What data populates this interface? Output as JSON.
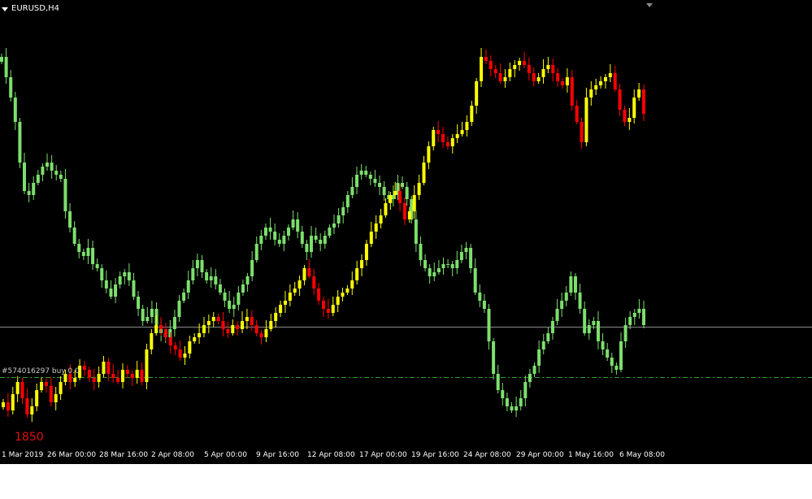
{
  "window": {
    "title": "EURUSD,H4"
  },
  "labels": {
    "order": "#574016297 buy 0.0",
    "counter": "1850"
  },
  "colors": {
    "background": "#000000",
    "foreground": "#ffffff",
    "series1_bull": "#ffff00",
    "series1_bear": "#ff0000",
    "series2": "#7ddf6d",
    "horizontal_line": "#8a8a8a",
    "order_line": "#2fa12f"
  },
  "chart_data": {
    "type": "candlestick",
    "symbol": "EURUSD",
    "timeframe": "H4",
    "x_tick_labels": [
      "1 Mar 2019",
      "26 Mar 00:00",
      "28 Mar 16:00",
      "2 Apr 08:00",
      "5 Apr 00:00",
      "9 Apr 16:00",
      "12 Apr 08:00",
      "17 Apr 00:00",
      "19 Apr 16:00",
      "24 Apr 08:00",
      "29 Apr 00:00",
      "1 May 16:00",
      "6 May 08:00"
    ],
    "y_scale": "unlabeled (price axis not shown)",
    "series": [
      {
        "style": "candles",
        "bull_color": "#ffff00",
        "bear_color": "#ff0000",
        "closes": [
          495,
          505,
          485,
          470,
          490,
          510,
          500,
          480,
          470,
          475,
          495,
          485,
          470,
          460,
          470,
          465,
          450,
          455,
          465,
          470,
          460,
          445,
          460,
          465,
          470,
          455,
          460,
          465,
          455,
          470,
          430,
          410,
          400,
          405,
          415,
          425,
          430,
          440,
          435,
          420,
          415,
          410,
          400,
          395,
          390,
          395,
          405,
          410,
          400,
          405,
          395,
          390,
          400,
          410,
          415,
          405,
          395,
          385,
          375,
          370,
          360,
          355,
          345,
          330,
          340,
          355,
          370,
          380,
          385,
          375,
          365,
          360,
          355,
          345,
          330,
          320,
          300,
          285,
          275,
          265,
          250,
          240,
          235,
          250,
          270,
          260,
          240,
          225,
          200,
          180,
          160,
          165,
          175,
          180,
          170,
          165,
          160,
          150,
          130,
          100,
          70,
          75,
          85,
          90,
          100,
          95,
          85,
          80,
          75,
          80,
          90,
          100,
          95,
          85,
          80,
          90,
          100,
          105,
          95,
          130,
          150,
          175,
          120,
          110,
          105,
          100,
          95,
          90,
          110,
          135,
          150,
          145,
          120,
          110,
          140
        ]
      },
      {
        "style": "candles",
        "color": "#7ddf6d",
        "closes": [
          70,
          95,
          120,
          150,
          200,
          235,
          240,
          225,
          215,
          205,
          200,
          210,
          215,
          220,
          260,
          280,
          300,
          310,
          315,
          305,
          325,
          330,
          345,
          355,
          365,
          350,
          340,
          335,
          345,
          365,
          380,
          395,
          390,
          380,
          400,
          410,
          415,
          405,
          390,
          370,
          360,
          345,
          330,
          320,
          335,
          345,
          340,
          350,
          360,
          370,
          380,
          375,
          360,
          350,
          340,
          320,
          300,
          290,
          280,
          285,
          295,
          300,
          290,
          280,
          270,
          285,
          300,
          310,
          290,
          295,
          300,
          290,
          280,
          275,
          265,
          255,
          240,
          230,
          215,
          210,
          215,
          220,
          225,
          230,
          240,
          245,
          240,
          225,
          230,
          245,
          270,
          300,
          320,
          330,
          340,
          335,
          330,
          325,
          325,
          330,
          320,
          310,
          305,
          330,
          360,
          370,
          380,
          420,
          460,
          480,
          490,
          500,
          505,
          500,
          490,
          470,
          460,
          450,
          430,
          420,
          410,
          395,
          380,
          370,
          360,
          340,
          360,
          380,
          410,
          400,
          395,
          420,
          430,
          440,
          450,
          455,
          420,
          400,
          390,
          385,
          380,
          400
        ]
      }
    ],
    "horizontal_lines": [
      {
        "style": "solid",
        "color": "#8a8a8a"
      },
      {
        "style": "dash-dot",
        "color": "#2fa12f"
      }
    ],
    "grid": false
  }
}
